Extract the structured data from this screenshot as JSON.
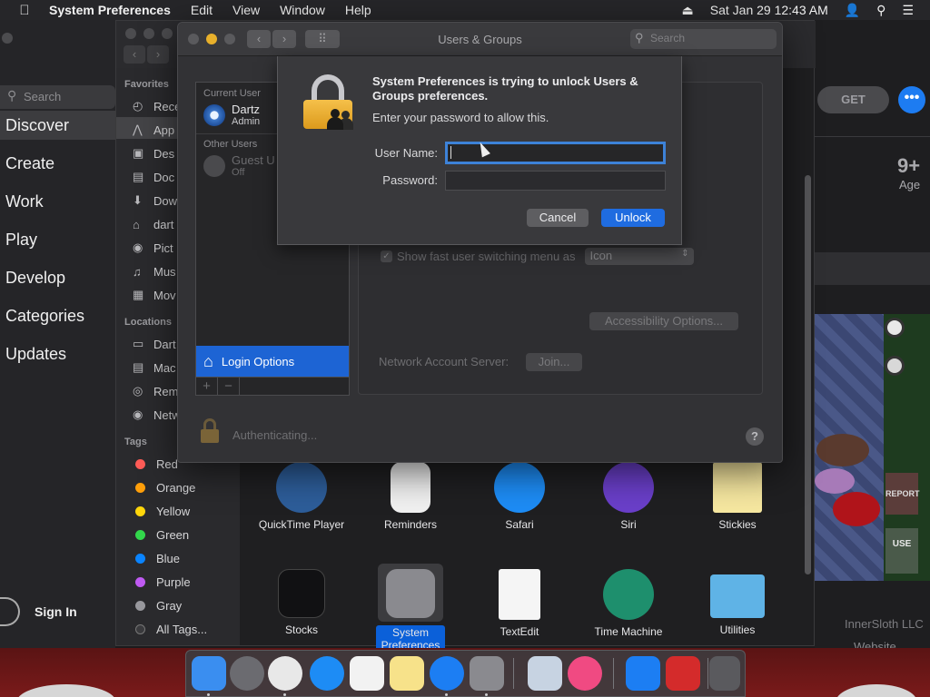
{
  "menubar": {
    "apple": "",
    "app_name": "System Preferences",
    "menus": [
      "Edit",
      "View",
      "Window",
      "Help"
    ],
    "datetime": "Sat Jan 29  12:43 AM"
  },
  "appstore": {
    "search_placeholder": "Search",
    "nav": [
      "Discover",
      "Create",
      "Work",
      "Play",
      "Develop",
      "Categories",
      "Updates"
    ],
    "selected_nav": "Discover",
    "sign_in": "Sign In",
    "get_label": "GET",
    "more_label": "•••",
    "age_value": "9+",
    "age_label": "Age",
    "developer": "InnerSloth LLC",
    "website": "Website",
    "game_report": "REPORT",
    "game_use": "USE"
  },
  "finder": {
    "sections": {
      "favorites": "Favorites",
      "locations": "Locations",
      "tags": "Tags"
    },
    "favorites": [
      "Rece",
      "App",
      "Des",
      "Doc",
      "Dow",
      "dart",
      "Pict",
      "Mus",
      "Mov"
    ],
    "locations": [
      "Dart",
      "Mac",
      "Rem",
      "Netw"
    ],
    "tags": [
      {
        "label": "Red",
        "color": "#ff5c57"
      },
      {
        "label": "Orange",
        "color": "#ff9f0a"
      },
      {
        "label": "Yellow",
        "color": "#ffd60a"
      },
      {
        "label": "Green",
        "color": "#32d74b"
      },
      {
        "label": "Blue",
        "color": "#0a84ff"
      },
      {
        "label": "Purple",
        "color": "#bf5af2"
      },
      {
        "label": "Gray",
        "color": "#98989d"
      },
      {
        "label": "All Tags...",
        "color": "#3a3a3d"
      }
    ],
    "apps_row1": [
      "QuickTime Player",
      "Reminders",
      "Safari",
      "Siri",
      "Stickies"
    ],
    "apps_row2": [
      "Stocks",
      "System Preferences",
      "TextEdit",
      "Time Machine",
      "Utilities"
    ],
    "app_colors": {
      "QuickTime Player": "#2d5d99",
      "Reminders": "#f0f0f0",
      "Safari": "#1d8cf5",
      "Siri": "#6a3fc9",
      "Stickies": "#f6e7a0",
      "Stocks": "#111113",
      "System Preferences": "#8a8a8f",
      "TextEdit": "#f5f5f5",
      "Time Machine": "#1e8f6d",
      "Utilities": "#5fb3e6"
    }
  },
  "users_groups": {
    "title": "Users & Groups",
    "search_placeholder": "Search",
    "current_user_heading": "Current User",
    "current_user": {
      "name": "Dartz",
      "role": "Admin"
    },
    "other_users_heading": "Other Users",
    "guest_user": {
      "name": "Guest U",
      "status": "Off"
    },
    "login_options": "Login Options",
    "add": "+",
    "remove": "−",
    "fast_switch_label": "Show fast user switching menu as",
    "fast_switch_value": "Icon",
    "accessibility_button": "Accessibility Options...",
    "network_label": "Network Account Server:",
    "join_button": "Join...",
    "authenticating": "Authenticating...",
    "help": "?"
  },
  "auth_sheet": {
    "title": "System Preferences is trying to unlock Users & Groups preferences.",
    "message": "Enter your password to allow this.",
    "username_label": "User Name:",
    "username_value": "",
    "password_label": "Password:",
    "password_value": "",
    "cancel": "Cancel",
    "unlock": "Unlock"
  },
  "dock": {
    "items": [
      {
        "name": "Finder",
        "color": "#3a8ef0",
        "running": true
      },
      {
        "name": "Launchpad",
        "color": "#6b6b70",
        "running": false
      },
      {
        "name": "Chrome",
        "color": "#e8e8e8",
        "running": true
      },
      {
        "name": "Safari",
        "color": "#1d8cf5",
        "running": false
      },
      {
        "name": "Calendar",
        "color": "#f2f2f2",
        "running": false
      },
      {
        "name": "Notes",
        "color": "#f7e28a",
        "running": false
      },
      {
        "name": "App Store",
        "color": "#1c7ef3",
        "running": true
      },
      {
        "name": "System Preferences",
        "color": "#8a8a8f",
        "running": true
      },
      {
        "name": "Preview",
        "color": "#c7d3e2",
        "running": false
      },
      {
        "name": "iTunes",
        "color": "#f04a82",
        "running": false
      },
      {
        "name": "App Store Installer",
        "color": "#1c7ef3",
        "running": false
      },
      {
        "name": "Close App",
        "color": "#d42b2b",
        "running": false
      },
      {
        "name": "Trash",
        "color": "#5a5a5e",
        "running": false
      }
    ]
  }
}
